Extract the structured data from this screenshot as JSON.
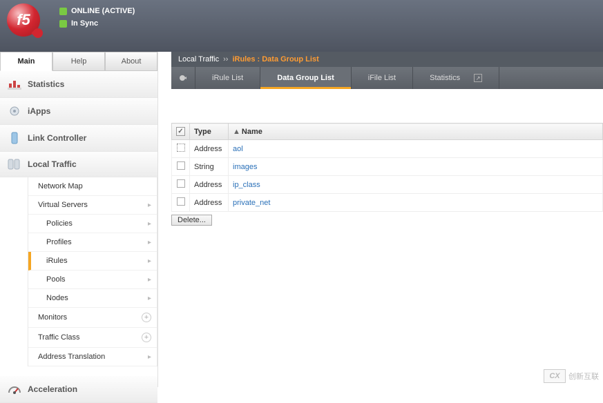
{
  "header": {
    "status1": "ONLINE (ACTIVE)",
    "status2": "In Sync",
    "logo_text": "f5"
  },
  "tabs": {
    "main": "Main",
    "help": "Help",
    "about": "About"
  },
  "nav": {
    "statistics": "Statistics",
    "iapps": "iApps",
    "link_controller": "Link Controller",
    "local_traffic": "Local Traffic",
    "network_map": "Network Map",
    "virtual_servers": "Virtual Servers",
    "policies": "Policies",
    "profiles": "Profiles",
    "irules": "iRules",
    "pools": "Pools",
    "nodes": "Nodes",
    "monitors": "Monitors",
    "traffic_class": "Traffic Class",
    "address_translation": "Address Translation",
    "acceleration": "Acceleration"
  },
  "breadcrumb": {
    "seg1": "Local Traffic",
    "sep": "››",
    "seg2": "iRules : Data Group List"
  },
  "toolbar": {
    "irule_list": "iRule List",
    "data_group_list": "Data Group List",
    "ifile_list": "iFile List",
    "statistics": "Statistics"
  },
  "table": {
    "headers": {
      "type": "Type",
      "name": "Name"
    },
    "rows": [
      {
        "type": "Address",
        "name": "aol"
      },
      {
        "type": "String",
        "name": "images"
      },
      {
        "type": "Address",
        "name": "ip_class"
      },
      {
        "type": "Address",
        "name": "private_net"
      }
    ],
    "delete": "Delete..."
  },
  "watermark": "创新互联"
}
